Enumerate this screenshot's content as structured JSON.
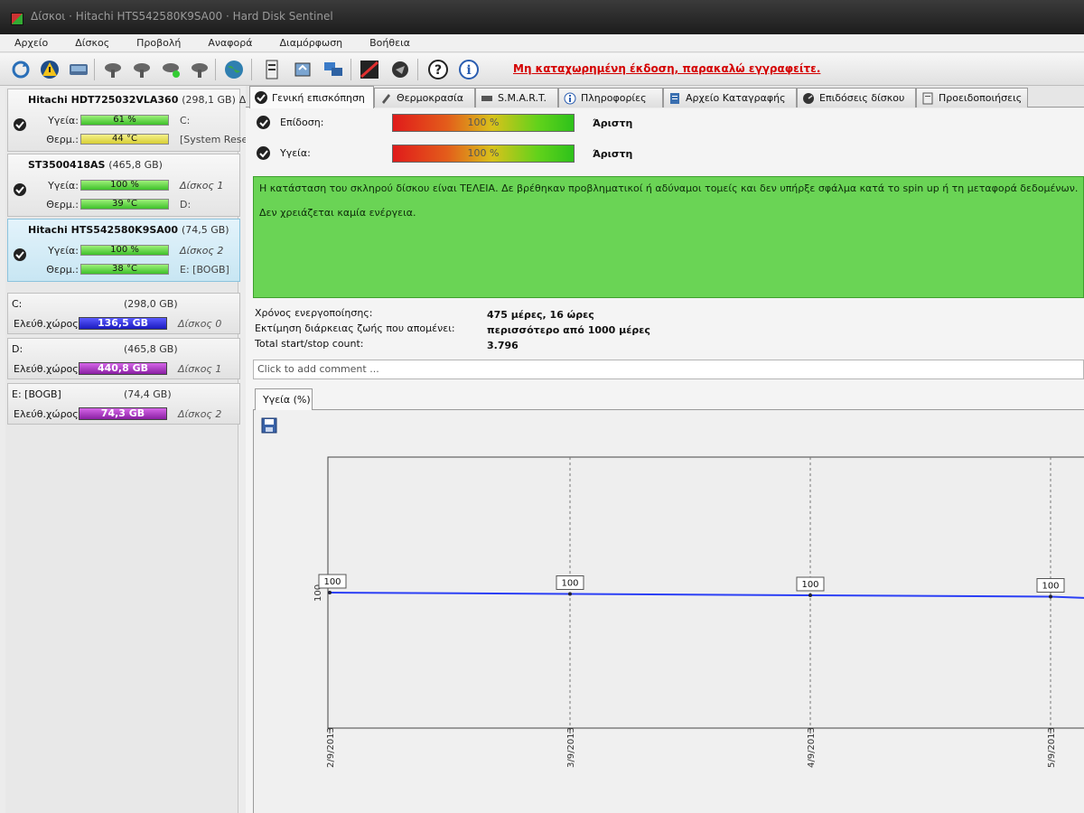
{
  "window": {
    "title": "Δίσκοι · Hitachi HTS542580K9SA00 · Hard Disk Sentinel"
  },
  "menu": [
    "Αρχείο",
    "Δίσκος",
    "Προβολή",
    "Αναφορά",
    "Διαμόρφωση",
    "Βοήθεια"
  ],
  "toolbar": {
    "banner": "Μη καταχωρημένη έκδοση, παρακαλώ εγγραφείτε.",
    "icons": [
      "refresh-icon",
      "warning-icon",
      "disk-icon",
      "disk-tool-icon",
      "disk-tool-icon",
      "disk-tool-icon",
      "disk-tool-icon",
      "globe-icon",
      "document-icon",
      "sync-icon",
      "computers-icon",
      "chart-icon",
      "mail-icon",
      "help-icon",
      "info-icon"
    ]
  },
  "disks": [
    {
      "name": "Hitachi HDT725032VLA360",
      "size": "(298,1 GB)",
      "extra": "Δίσκ",
      "health_label": "Υγεία:",
      "health": "61 %",
      "health_pct": 61,
      "temp_label": "Θερμ.:",
      "temp": "44 °C",
      "temp_color": "yellow",
      "health_extra": "C:",
      "temp_extra": "[System Rese"
    },
    {
      "name": "ST3500418AS",
      "size": "(465,8 GB)",
      "extra": "",
      "health_label": "Υγεία:",
      "health": "100 %",
      "health_pct": 100,
      "temp_label": "Θερμ.:",
      "temp": "39 °C",
      "temp_color": "green",
      "health_extra": "Δίσκος 1",
      "temp_extra": "D:"
    },
    {
      "name": "Hitachi HTS542580K9SA00",
      "size": "(74,5 GB)",
      "extra": "",
      "health_label": "Υγεία:",
      "health": "100 %",
      "health_pct": 100,
      "temp_label": "Θερμ.:",
      "temp": "38 °C",
      "temp_color": "green",
      "health_extra": "Δίσκος 2",
      "temp_extra": "E: [BOGB]"
    }
  ],
  "volumes": [
    {
      "name": "C:",
      "size": "(298,0 GB)",
      "free_label": "Ελεύθ.χώρος",
      "free": "136,5 GB",
      "color": "blue",
      "disk": "Δίσκος 0"
    },
    {
      "name": "D:",
      "size": "(465,8 GB)",
      "free_label": "Ελεύθ.χώρος",
      "free": "440,8 GB",
      "color": "purple",
      "disk": "Δίσκος 1"
    },
    {
      "name": "E: [BOGB]",
      "size": "(74,4 GB)",
      "free_label": "Ελεύθ.χώρος",
      "free": "74,3 GB",
      "color": "purple",
      "disk": "Δίσκος 2"
    }
  ],
  "tabs": [
    {
      "label": "Γενική επισκόπηση",
      "icon": "check-icon",
      "active": true
    },
    {
      "label": "Θερμοκρασία",
      "icon": "thermometer-icon",
      "active": false
    },
    {
      "label": "S.M.A.R.T.",
      "icon": "smart-icon",
      "active": false
    },
    {
      "label": "Πληροφορίες",
      "icon": "info-icon",
      "active": false
    },
    {
      "label": "Αρχείο Καταγραφής",
      "icon": "log-icon",
      "active": false
    },
    {
      "label": "Επιδόσεις δίσκου",
      "icon": "performance-icon",
      "active": false
    },
    {
      "label": "Προειδοποιήσεις",
      "icon": "alert-icon",
      "active": false
    }
  ],
  "overview": {
    "performance": {
      "label": "Επίδοση:",
      "value": "100 %",
      "rating": "Άριστη"
    },
    "health": {
      "label": "Υγεία:",
      "value": "100 %",
      "rating": "Άριστη"
    },
    "status_lines": [
      "Η κατάσταση του σκληρού δίσκου είναι ΤΕΛΕΙΑ. Δε βρέθηκαν προβληματικοί ή αδύναμοι τομείς και δεν υπήρξε σφάλμα κατά το spin up ή τη μεταφορά δεδομένων.",
      "Δεν χρειάζεται καμία ενέργεια."
    ],
    "info": [
      {
        "label": "Χρόνος ενεργοποίησης:",
        "value": "475 μέρες, 16 ώρες"
      },
      {
        "label": "Εκτίμηση διάρκειας ζωής που απομένει:",
        "value": "περισσότερο από 1000 μέρες"
      },
      {
        "label": "Total start/stop count:",
        "value": "3.796"
      }
    ],
    "comment_placeholder": "Click to add comment ..."
  },
  "chart_tab": "Υγεία (%)",
  "chart_data": {
    "type": "line",
    "title": "",
    "xlabel": "",
    "ylabel": "",
    "categories": [
      "2/9/2013",
      "3/9/2013",
      "4/9/2013",
      "5/9/2013"
    ],
    "values": [
      100,
      100,
      100,
      100
    ],
    "y_tick_label": "100",
    "grid": true,
    "line_color": "#2b3ff5"
  }
}
